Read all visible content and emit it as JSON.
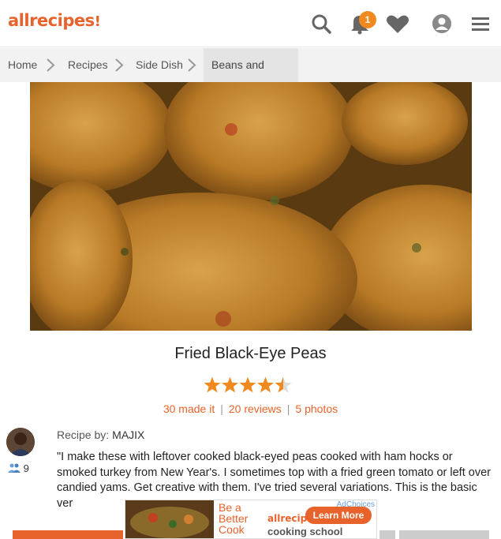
{
  "header": {
    "logo_text": "allrecipes",
    "notification_count": "1",
    "brand_color": "#e8632b",
    "icons": [
      "search-icon",
      "bell-icon",
      "heart-icon",
      "profile-icon",
      "menu-icon"
    ]
  },
  "breadcrumb": [
    {
      "label": "Home"
    },
    {
      "label": "Recipes"
    },
    {
      "label": "Side Dish"
    },
    {
      "label": "Beans and Peas"
    }
  ],
  "recipe": {
    "title": "Fried Black-Eye Peas",
    "rating": 4.5,
    "made_it": "30 made it",
    "reviews": "20 reviews",
    "photos": "5 photos",
    "recipe_by_label": "Recipe by:",
    "author": "MAJIX",
    "followers": "9",
    "description": "\"I make these with leftover cooked black-eyed peas cooked with ham hocks or smoked turkey from New Year's. I sometimes top with a fried green tomato or left over candied yams. Get creative with them. I've tried several variations. This is the basic ver"
  },
  "ad": {
    "headline": "Be a Better Cook",
    "brand": "allrecipes",
    "subbrand": "cooking school",
    "cta": "Learn More",
    "adchoices": "AdChoices"
  }
}
